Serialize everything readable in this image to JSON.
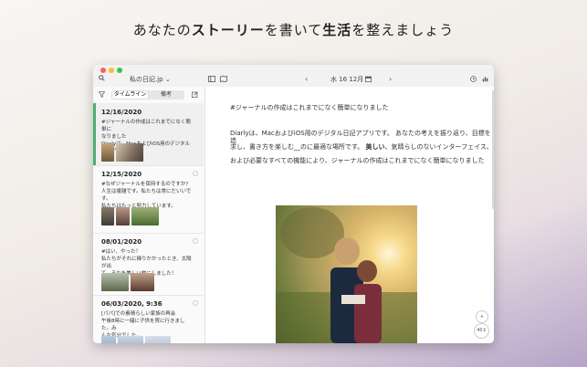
{
  "headline": {
    "part1": "あなたの",
    "part2": "ストーリー",
    "part3": "を書いて",
    "part4": "生活",
    "part5": "を整えましょう"
  },
  "titlebar": {
    "journal_name": "私の日記.jp",
    "date": "水 16 12月"
  },
  "sidebar": {
    "segment_timeline": "タイムライン",
    "segment_notes": "備考",
    "entries": [
      {
        "date": "12/16/2020",
        "line1": "#ジャーナルの作成はこれまでになく簡単に",
        "line2": "なりました",
        "line3": "Diarlyは、MacおよびiOS用のデジタル日記ア"
      },
      {
        "date": "12/15/2020",
        "line1": "#なぜジャーナルを保持するのですか?",
        "line2": "人生は複雑です。私たちは常にだいいです。",
        "line3": "私たちはもっと努力しています。"
      },
      {
        "date": "08/01/2020",
        "line1": "#はい、やった！",
        "line2": "私たちがそれに挿りかかったとき、太陽が出",
        "line3": "て、それを美しい旅にしました！"
      },
      {
        "date": "06/03/2020, 9:36",
        "line1": "[パパ]での素晴らしい家族の再会",
        "line2": "午後8時に一緒に子供を買に行きました。み",
        "line3": "んな気分でした。"
      }
    ]
  },
  "editor": {
    "heading": "#ジャーナルの作成はこれまでになく簡単になりました",
    "para1a": "Diarlyは、MacおよびiOS用のデジタル日記アプリです。 あなたの考えを振り返り、目標を追",
    "para1b_pre": "求し、書き方を楽しむ__のに最適な場所です。 ",
    "para1b_bold": "美しい",
    "para1b_post": "、気晴らしのないインターフェイス、",
    "para1c": "および必要なすべての機能により、ジャーナルの作成はこれまでになく簡単になりました",
    "word_count": "40↕"
  },
  "colors": {
    "accent": "#4cae72",
    "close": "#fc5f57",
    "minimize": "#fdbc2e",
    "zoom": "#33c748"
  }
}
